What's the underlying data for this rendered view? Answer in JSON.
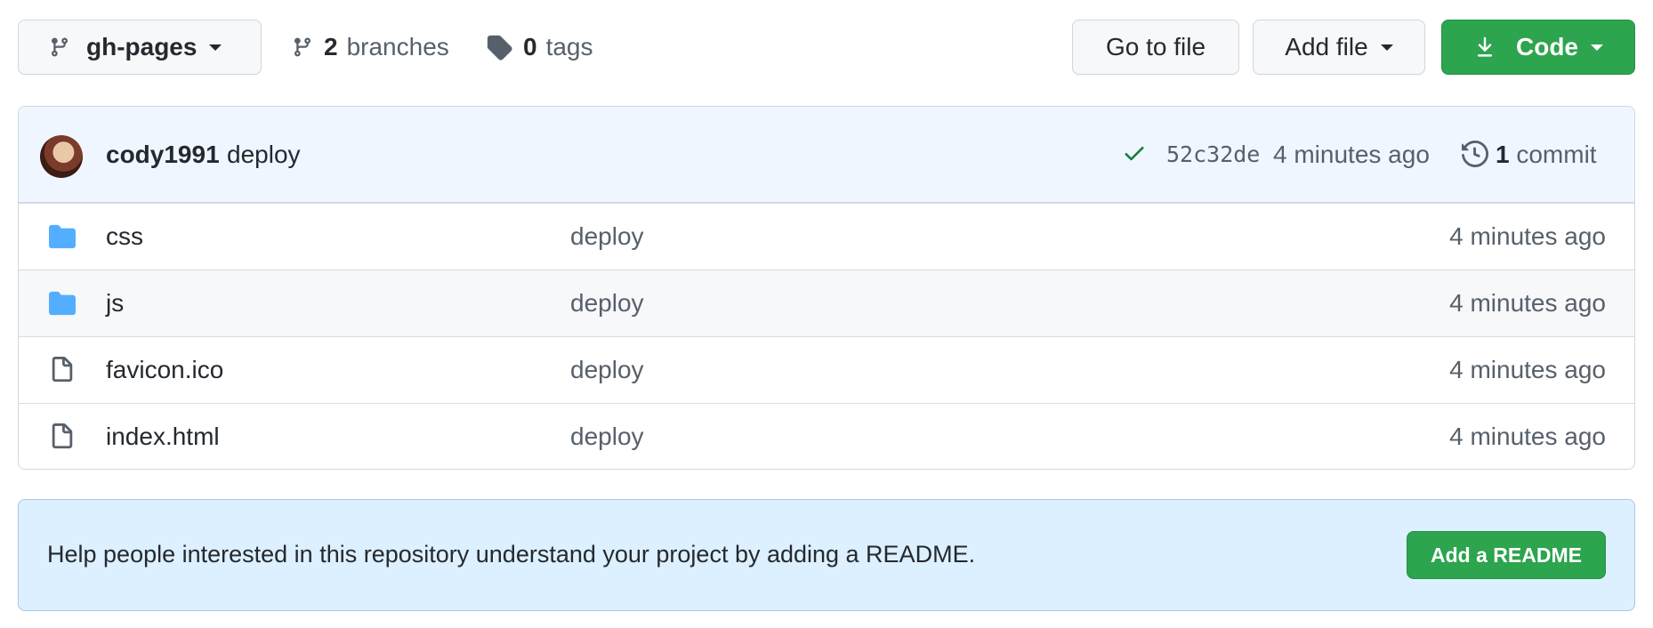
{
  "toolbar": {
    "branch": "gh-pages",
    "branches_count": "2",
    "branches_label": "branches",
    "tags_count": "0",
    "tags_label": "tags",
    "goto_file": "Go to file",
    "add_file": "Add file",
    "code": "Code"
  },
  "commit": {
    "author": "cody1991",
    "message": "deploy",
    "sha": "52c32de",
    "time": "4 minutes ago",
    "count": "1",
    "count_label": "commit",
    "status": "success"
  },
  "files": [
    {
      "type": "folder",
      "name": "css",
      "message": "deploy",
      "time": "4 minutes ago"
    },
    {
      "type": "folder",
      "name": "js",
      "message": "deploy",
      "time": "4 minutes ago"
    },
    {
      "type": "file",
      "name": "favicon.ico",
      "message": "deploy",
      "time": "4 minutes ago"
    },
    {
      "type": "file",
      "name": "index.html",
      "message": "deploy",
      "time": "4 minutes ago"
    }
  ],
  "readme": {
    "prompt": "Help people interested in this repository understand your project by adding a README.",
    "button": "Add a README"
  },
  "colors": {
    "primary_green": "#2da44e",
    "folder_blue": "#54aeff",
    "commit_header_bg": "#f0f6ff",
    "readme_bg": "#ddf0ff"
  }
}
